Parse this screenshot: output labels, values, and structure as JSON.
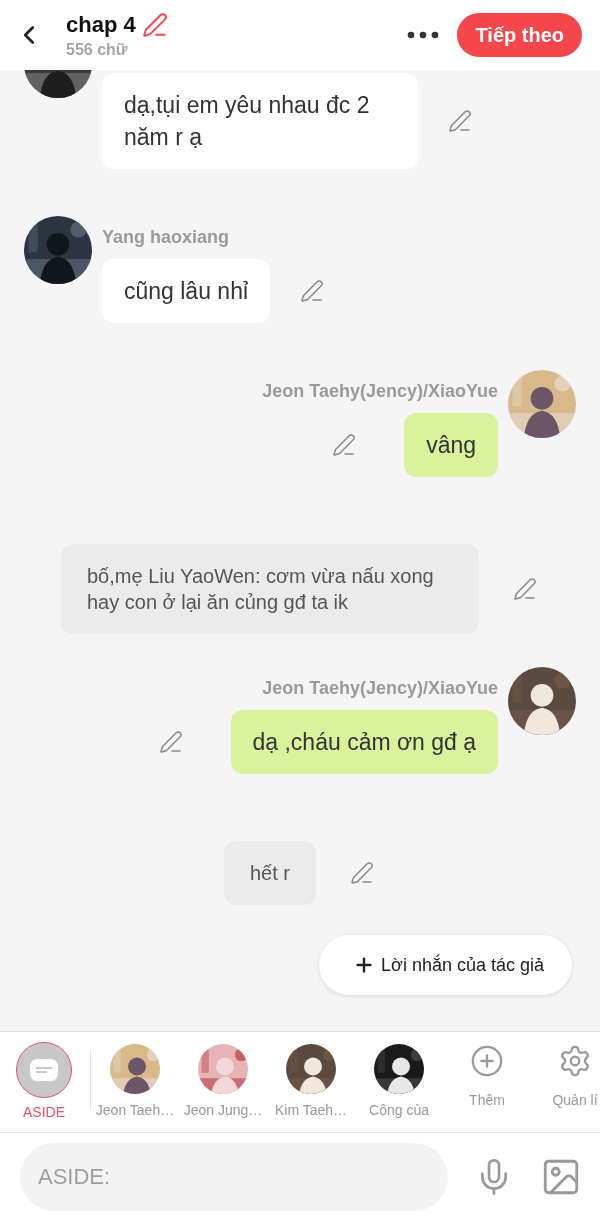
{
  "header": {
    "title": "chap 4",
    "word_count": "556 chữ",
    "next_button": "Tiếp theo"
  },
  "messages": [
    {
      "kind": "left",
      "text": "dạ,tụi em yêu nhau đc 2 năm r ạ"
    },
    {
      "kind": "left",
      "name": "Yang haoxiang",
      "text": "cũng lâu nhỉ"
    },
    {
      "kind": "right",
      "name": "Jeon Taehy(Jency)/XiaoYue",
      "text": "vâng"
    },
    {
      "kind": "aside",
      "text": "bố,mẹ Liu YaoWen: cơm vừa nấu xong hay con ở lại ăn củng gđ ta ik"
    },
    {
      "kind": "right",
      "name": "Jeon Taehy(Jency)/XiaoYue",
      "text": "dạ ,cháu cảm ơn gđ ạ"
    },
    {
      "kind": "aside",
      "text": "hết r"
    }
  ],
  "author_note_button": "Lời nhắn của tác giả",
  "characters": [
    {
      "kind": "aside",
      "label": "ASIDE",
      "selected": true
    },
    {
      "kind": "avatar",
      "label": "Jeon Taeh…",
      "selected": false
    },
    {
      "kind": "avatar",
      "label": "Jeon Jung…",
      "selected": false
    },
    {
      "kind": "avatar",
      "label": "Kim Taeh…",
      "selected": false
    },
    {
      "kind": "avatar",
      "label": "Công của",
      "selected": false
    },
    {
      "kind": "add",
      "label": "Thêm",
      "selected": false
    },
    {
      "kind": "settings",
      "label": "Quản lí",
      "selected": false
    }
  ],
  "input": {
    "placeholder": "ASIDE:"
  }
}
